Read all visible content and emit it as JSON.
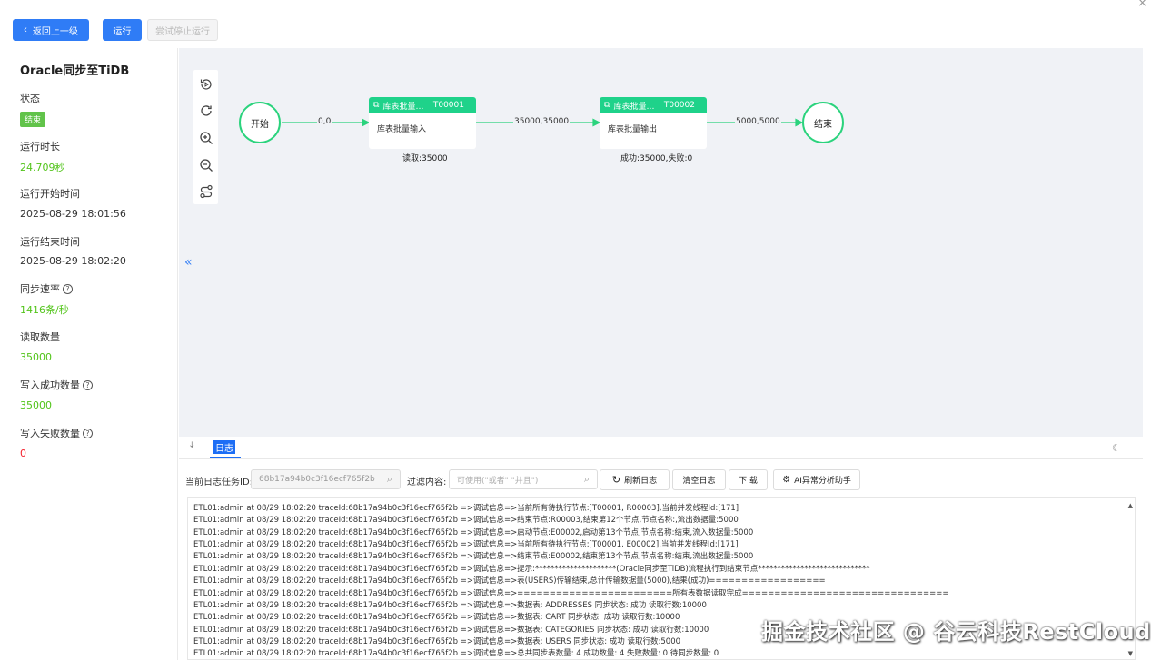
{
  "toolbar": {
    "back_label": "返回上一级",
    "run_label": "运行",
    "stop_label": "尝试停止运行"
  },
  "summary": {
    "title": "Oracle同步至TiDB",
    "status_label": "状态",
    "status_value": "结束",
    "duration_label": "运行时长",
    "duration_value": "24.709秒",
    "start_label": "运行开始时间",
    "start_value": "2025-08-29 18:01:56",
    "end_label": "运行结束时间",
    "end_value": "2025-08-29 18:02:20",
    "rate_label": "同步速率",
    "rate_value": "1416条/秒",
    "read_label": "读取数量",
    "read_value": "35000",
    "write_ok_label": "写入成功数量",
    "write_ok_value": "35000",
    "write_fail_label": "写入失败数量",
    "write_fail_value": "0"
  },
  "flow": {
    "start_node": "开始",
    "end_node": "结束",
    "task1": {
      "title": "库表批量…",
      "id": "T00001",
      "body": "库表批量输入",
      "caption": "读取:35000"
    },
    "task2": {
      "title": "库表批量…",
      "id": "T00002",
      "body": "库表批量输出",
      "caption": "成功:35000,失败:0"
    },
    "edges": [
      "0,0",
      "35000,35000",
      "5000,5000"
    ],
    "collapse_icon": "«"
  },
  "log_panel": {
    "download_icon": "⤓",
    "tab_label": "日志",
    "task_id_label": "当前日志任务ID:",
    "task_id_value": "68b17a94b0c3f16ecf765f2b",
    "filter_label": "过滤内容:",
    "filter_placeholder": "可使用(\"或者\"  \"并且\")",
    "refresh_label": "刷新日志",
    "clear_label": "清空日志",
    "download_label": "下 载",
    "ai_label": "AI异常分析助手",
    "lines": [
      "ETL01:admin at 08/29 18:02:20 traceId:68b17a94b0c3f16ecf765f2b =>调试信息=>当前所有待执行节点:[T00001, R00003],当前并发线程Id:[171]",
      "ETL01:admin at 08/29 18:02:20 traceId:68b17a94b0c3f16ecf765f2b =>调试信息=>结束节点:R00003,结束第12个节点,节点名称:,流出数据量:5000",
      "ETL01:admin at 08/29 18:02:20 traceId:68b17a94b0c3f16ecf765f2b =>调试信息=>启动节点:E00002,启动第13个节点,节点名称:结束,流入数据量:5000",
      "ETL01:admin at 08/29 18:02:20 traceId:68b17a94b0c3f16ecf765f2b =>调试信息=>当前所有待执行节点:[T00001, E00002],当前并发线程Id:[171]",
      "ETL01:admin at 08/29 18:02:20 traceId:68b17a94b0c3f16ecf765f2b =>调试信息=>结束节点:E00002,结束第13个节点,节点名称:结束,流出数据量:5000",
      "ETL01:admin at 08/29 18:02:20 traceId:68b17a94b0c3f16ecf765f2b =>调试信息=>提示:*********************(Oracle同步至TiDB)流程执行到结束节点*****************************",
      "ETL01:admin at 08/29 18:02:20 traceId:68b17a94b0c3f16ecf765f2b =>调试信息=>表(USERS)传输结束,总计传输数据量(5000),结果(成功)==================",
      "ETL01:admin at 08/29 18:02:20 traceId:68b17a94b0c3f16ecf765f2b =>调试信息=>========================所有表数据读取完成================================",
      "ETL01:admin at 08/29 18:02:20 traceId:68b17a94b0c3f16ecf765f2b =>调试信息=>数据表: ADDRESSES 同步状态: 成功 读取行数:10000",
      "ETL01:admin at 08/29 18:02:20 traceId:68b17a94b0c3f16ecf765f2b =>调试信息=>数据表: CART 同步状态: 成功 读取行数:10000",
      "ETL01:admin at 08/29 18:02:20 traceId:68b17a94b0c3f16ecf765f2b =>调试信息=>数据表: CATEGORIES 同步状态: 成功 读取行数:10000",
      "ETL01:admin at 08/29 18:02:20 traceId:68b17a94b0c3f16ecf765f2b =>调试信息=>数据表: USERS 同步状态: 成功 读取行数:5000",
      "ETL01:admin at 08/29 18:02:20 traceId:68b17a94b0c3f16ecf765f2b =>调试信息=>总共同步表数量: 4 成功数量: 4 失败数量: 0 待同步数量: 0"
    ]
  },
  "watermark": "掘金技术社区 @ 谷云科技RestCloud",
  "colors": {
    "primary": "#2f7cf6",
    "node_green": "#1fd28a",
    "success": "#52c41a",
    "danger": "#f5222d"
  }
}
